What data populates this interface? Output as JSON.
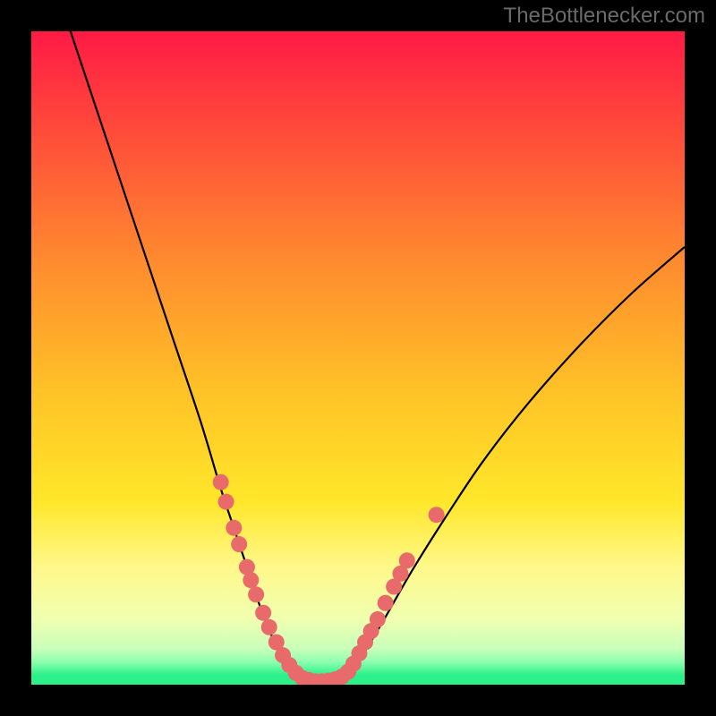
{
  "watermark": "TheBottleneсker.com",
  "chart_data": {
    "type": "line",
    "title": "",
    "xlabel": "",
    "ylabel": "",
    "xlim": [
      0,
      100
    ],
    "ylim": [
      0,
      100
    ],
    "background": {
      "description": "vertical gradient red→orange→yellow→pale-yellow with thin green band at bottom",
      "stops": [
        {
          "offset": 0.0,
          "color": "#ff1a45"
        },
        {
          "offset": 0.15,
          "color": "#ff4a3a"
        },
        {
          "offset": 0.35,
          "color": "#ff8a2f"
        },
        {
          "offset": 0.55,
          "color": "#ffc227"
        },
        {
          "offset": 0.72,
          "color": "#ffe72a"
        },
        {
          "offset": 0.82,
          "color": "#fff88a"
        },
        {
          "offset": 0.9,
          "color": "#f0ffb0"
        },
        {
          "offset": 0.945,
          "color": "#c9ffba"
        },
        {
          "offset": 0.965,
          "color": "#8effb0"
        },
        {
          "offset": 0.985,
          "color": "#2cf08a"
        },
        {
          "offset": 1.0,
          "color": "#2cf08a"
        }
      ]
    },
    "series": [
      {
        "name": "bottleneck-curve",
        "description": "V-shaped curve; steep descent from top-left, flat valley ~x 40-48, shallower ascent to upper-right",
        "x": [
          6,
          10,
          14,
          18,
          22,
          26,
          29,
          31,
          33,
          35,
          37,
          39,
          41,
          43,
          45,
          47,
          49,
          51,
          54,
          58,
          63,
          69,
          76,
          84,
          92,
          100
        ],
        "values": [
          100,
          88,
          76,
          64,
          52,
          40,
          30,
          24,
          18,
          12,
          7,
          3,
          1,
          0.5,
          0.5,
          0.8,
          2,
          5,
          10,
          17,
          25,
          34,
          43,
          52,
          60,
          67
        ]
      }
    ],
    "markers": {
      "name": "highlight-points",
      "description": "salmon/pink circular markers clustered along lower portion of both curve arms and across valley floor",
      "color": "#e86a6a",
      "radius": 9,
      "points": [
        {
          "x": 29.0,
          "y": 31.0
        },
        {
          "x": 29.8,
          "y": 28.0
        },
        {
          "x": 31.0,
          "y": 24.0
        },
        {
          "x": 31.8,
          "y": 21.5
        },
        {
          "x": 33.0,
          "y": 18.0
        },
        {
          "x": 33.6,
          "y": 16.0
        },
        {
          "x": 34.4,
          "y": 13.8
        },
        {
          "x": 35.5,
          "y": 11.0
        },
        {
          "x": 36.4,
          "y": 8.8
        },
        {
          "x": 37.5,
          "y": 6.5
        },
        {
          "x": 38.5,
          "y": 4.5
        },
        {
          "x": 39.5,
          "y": 3.0
        },
        {
          "x": 40.5,
          "y": 1.8
        },
        {
          "x": 41.5,
          "y": 1.0
        },
        {
          "x": 42.5,
          "y": 0.7
        },
        {
          "x": 43.5,
          "y": 0.5
        },
        {
          "x": 44.5,
          "y": 0.5
        },
        {
          "x": 45.5,
          "y": 0.6
        },
        {
          "x": 46.5,
          "y": 0.8
        },
        {
          "x": 47.5,
          "y": 1.2
        },
        {
          "x": 48.5,
          "y": 2.0
        },
        {
          "x": 49.3,
          "y": 3.2
        },
        {
          "x": 50.2,
          "y": 4.8
        },
        {
          "x": 51.1,
          "y": 6.5
        },
        {
          "x": 52.0,
          "y": 8.2
        },
        {
          "x": 53.0,
          "y": 10.0
        },
        {
          "x": 54.2,
          "y": 12.5
        },
        {
          "x": 55.5,
          "y": 15.0
        },
        {
          "x": 56.5,
          "y": 17.0
        },
        {
          "x": 57.5,
          "y": 19.0
        },
        {
          "x": 62.0,
          "y": 26.0
        }
      ]
    }
  }
}
